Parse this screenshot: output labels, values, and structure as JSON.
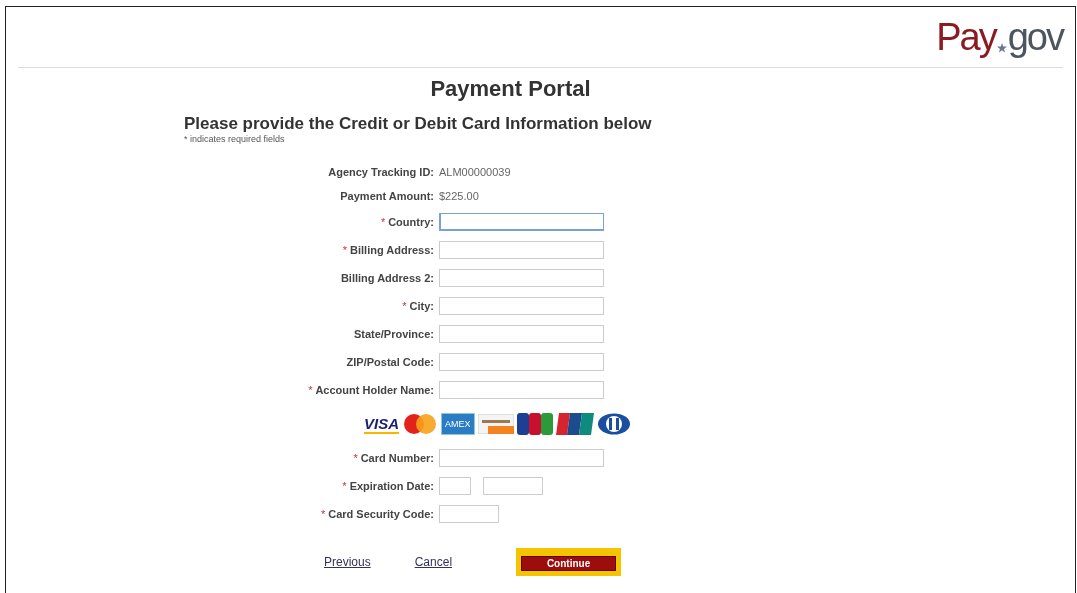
{
  "logo": {
    "part_1": "Pay",
    "part_2": "gov"
  },
  "title": "Payment Portal",
  "heading": "Please provide the Credit or Debit Card Information below",
  "required_note": "* indicates required fields",
  "fields": [
    {
      "kind": "text",
      "label": "Agency Tracking ID:",
      "value": "ALM00000039"
    },
    {
      "kind": "text",
      "label": "Payment Amount:",
      "value": "$225.00"
    },
    {
      "kind": "input",
      "mark": "*",
      "label": "Country:",
      "focused": true
    },
    {
      "kind": "input",
      "mark": "*",
      "label": "Billing Address:",
      "focused": false
    },
    {
      "kind": "input",
      "label": "Billing Address 2:",
      "focused": false
    },
    {
      "kind": "input",
      "mark": "*",
      "label": "City:",
      "focused": false
    },
    {
      "kind": "input",
      "label": "State/Province:",
      "focused": false
    },
    {
      "kind": "input",
      "label": "ZIP/Postal Code:",
      "focused": false
    },
    {
      "kind": "input",
      "mark": "*",
      "label": "Account Holder Name:",
      "focused": false
    },
    {
      "kind": "cards",
      "logos": [
        {
          "kind": "visa",
          "label": "VISA"
        },
        {
          "kind": "mastercard"
        },
        {
          "kind": "amex",
          "label": "AMEX"
        },
        {
          "kind": "discover"
        },
        {
          "kind": "jcb"
        },
        {
          "kind": "unionpay"
        },
        {
          "kind": "diners"
        }
      ]
    },
    {
      "kind": "input",
      "mark": "*",
      "label": "Card Number:",
      "focused": false
    },
    {
      "kind": "date",
      "mark": "*",
      "label": "Expiration Date:"
    },
    {
      "kind": "short_input",
      "mark": "*",
      "label": "Card Security Code:",
      "focused": false
    }
  ],
  "links": [
    "Previous",
    "Cancel"
  ],
  "continue": {
    "label": "Continue",
    "focused": true
  }
}
